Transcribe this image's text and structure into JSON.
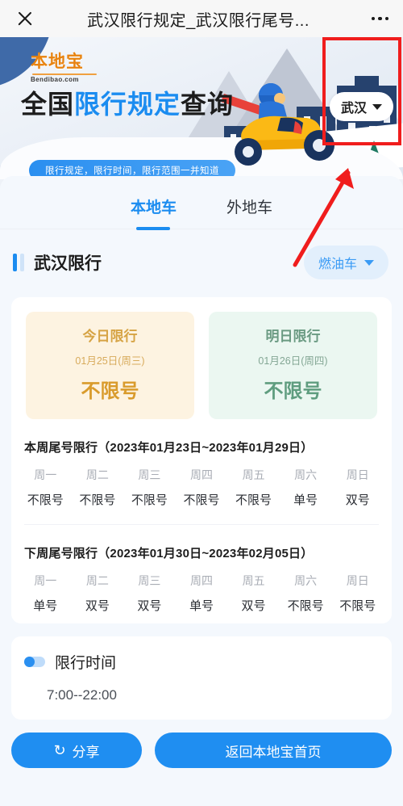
{
  "navbar": {
    "close_icon": "close-icon",
    "title": "武汉限行规定_武汉限行尾号...",
    "more_icon": "more-dots-icon"
  },
  "banner": {
    "logo_cn": "本地宝",
    "logo_en": "Bendibao.com",
    "headline_pre": "全国",
    "headline_hl": "限行规定",
    "headline_post": "查询",
    "subtitle": "限行规定，限行时间，限行范围一并知道",
    "city_selector": {
      "value": "武汉",
      "icon": "chevron-down-icon"
    }
  },
  "tabs": [
    {
      "label": "本地车",
      "active": true
    },
    {
      "label": "外地车",
      "active": false
    }
  ],
  "section": {
    "title": "武汉限行",
    "fuel_selector": {
      "value": "燃油车",
      "icon": "chevron-down-icon"
    }
  },
  "day_cards": [
    {
      "label": "今日限行",
      "date": "01月25日(周三)",
      "value": "不限号"
    },
    {
      "label": "明日限行",
      "date": "01月26日(周四)",
      "value": "不限号"
    }
  ],
  "weeks": [
    {
      "title": "本周尾号限行（2023年01月23日~2023年01月29日）",
      "days": [
        "周一",
        "周二",
        "周三",
        "周四",
        "周五",
        "周六",
        "周日"
      ],
      "values": [
        "不限号",
        "不限号",
        "不限号",
        "不限号",
        "不限号",
        "单号",
        "双号"
      ]
    },
    {
      "title": "下周尾号限行（2023年01月30日~2023年02月05日）",
      "days": [
        "周一",
        "周二",
        "周三",
        "周四",
        "周五",
        "周六",
        "周日"
      ],
      "values": [
        "单号",
        "双号",
        "双号",
        "单号",
        "双号",
        "不限号",
        "不限号"
      ]
    }
  ],
  "time_section": {
    "toggle_icon": "toggle-on-icon",
    "label": "限行时间",
    "value": "7:00--22:00"
  },
  "buttons": {
    "share_icon": "refresh-share-icon",
    "share_label": "分享",
    "home_label": "返回本地宝首页"
  },
  "colors": {
    "accent_blue": "#1b8cf0",
    "brand_orange": "#e8830f",
    "today_card": "#fdf3e1",
    "tomorrow_card": "#ebf7f1",
    "annotation_red": "#f01d1d"
  }
}
